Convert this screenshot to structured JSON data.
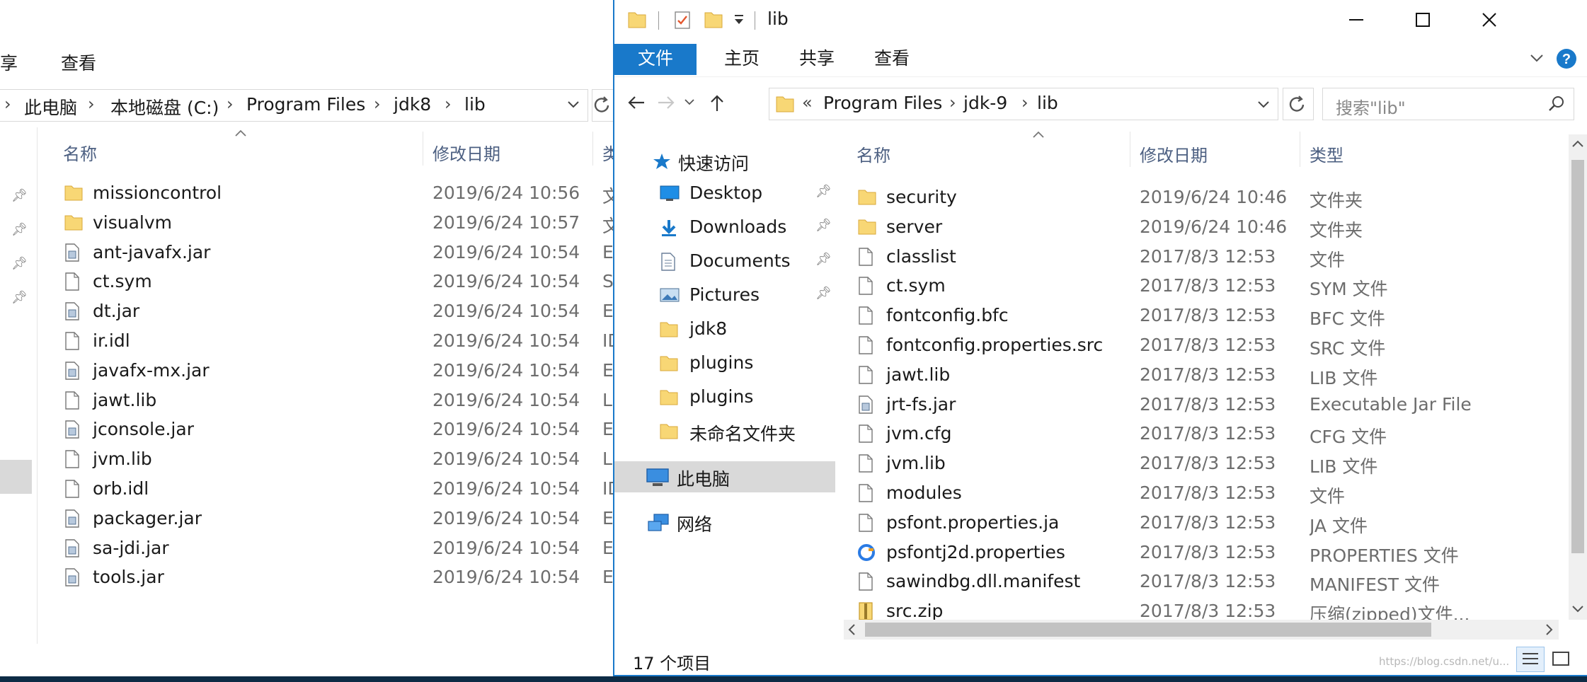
{
  "left_window": {
    "ribbon_tabs": [
      "享",
      "查看"
    ],
    "breadcrumb": [
      "此电脑",
      "本地磁盘 (C:)",
      "Program Files",
      "jdk8",
      "lib"
    ],
    "columns": {
      "name": "名称",
      "date": "修改日期",
      "type": "类"
    },
    "files": [
      {
        "name": "missioncontrol",
        "date": "2019/6/24 10:56",
        "type": "文",
        "icon": "folder-icon"
      },
      {
        "name": "visualvm",
        "date": "2019/6/24 10:57",
        "type": "文",
        "icon": "folder-icon"
      },
      {
        "name": "ant-javafx.jar",
        "date": "2019/6/24 10:54",
        "type": "E",
        "icon": "jar-file-icon"
      },
      {
        "name": "ct.sym",
        "date": "2019/6/24 10:54",
        "type": "S",
        "icon": "file-icon"
      },
      {
        "name": "dt.jar",
        "date": "2019/6/24 10:54",
        "type": "E",
        "icon": "jar-file-icon"
      },
      {
        "name": "ir.idl",
        "date": "2019/6/24 10:54",
        "type": "ID",
        "icon": "file-icon"
      },
      {
        "name": "javafx-mx.jar",
        "date": "2019/6/24 10:54",
        "type": "E",
        "icon": "jar-file-icon"
      },
      {
        "name": "jawt.lib",
        "date": "2019/6/24 10:54",
        "type": "L",
        "icon": "file-icon"
      },
      {
        "name": "jconsole.jar",
        "date": "2019/6/24 10:54",
        "type": "E",
        "icon": "jar-file-icon"
      },
      {
        "name": "jvm.lib",
        "date": "2019/6/24 10:54",
        "type": "L",
        "icon": "file-icon"
      },
      {
        "name": "orb.idl",
        "date": "2019/6/24 10:54",
        "type": "ID",
        "icon": "file-icon"
      },
      {
        "name": "packager.jar",
        "date": "2019/6/24 10:54",
        "type": "E",
        "icon": "jar-file-icon"
      },
      {
        "name": "sa-jdi.jar",
        "date": "2019/6/24 10:54",
        "type": "E",
        "icon": "jar-file-icon"
      },
      {
        "name": "tools.jar",
        "date": "2019/6/24 10:54",
        "type": "E",
        "icon": "jar-file-icon"
      }
    ]
  },
  "right_window": {
    "title": "lib",
    "ribbon_tabs": {
      "file": "文件",
      "home": "主页",
      "share": "共享",
      "view": "查看"
    },
    "breadcrumb": {
      "overflow": "«",
      "items": [
        "Program Files",
        "jdk-9",
        "lib"
      ]
    },
    "search_placeholder": "搜索\"lib\"",
    "nav": {
      "quick_access": "快速访问",
      "items": [
        {
          "label": "Desktop",
          "icon": "desktop-icon",
          "pinned": true
        },
        {
          "label": "Downloads",
          "icon": "downloads-icon",
          "pinned": true
        },
        {
          "label": "Documents",
          "icon": "documents-icon",
          "pinned": true
        },
        {
          "label": "Pictures",
          "icon": "pictures-icon",
          "pinned": true
        },
        {
          "label": "jdk8",
          "icon": "folder-icon",
          "pinned": false
        },
        {
          "label": "plugins",
          "icon": "folder-icon",
          "pinned": false
        },
        {
          "label": "plugins",
          "icon": "folder-icon",
          "pinned": false
        },
        {
          "label": "未命名文件夹",
          "icon": "folder-icon",
          "pinned": false
        }
      ],
      "this_pc": "此电脑",
      "network": "网络"
    },
    "columns": {
      "name": "名称",
      "date": "修改日期",
      "type": "类型"
    },
    "files": [
      {
        "name": "security",
        "date": "2019/6/24 10:46",
        "type": "文件夹",
        "icon": "folder-icon"
      },
      {
        "name": "server",
        "date": "2019/6/24 10:46",
        "type": "文件夹",
        "icon": "folder-icon"
      },
      {
        "name": "classlist",
        "date": "2017/8/3 12:53",
        "type": "文件",
        "icon": "file-icon"
      },
      {
        "name": "ct.sym",
        "date": "2017/8/3 12:53",
        "type": "SYM 文件",
        "icon": "file-icon"
      },
      {
        "name": "fontconfig.bfc",
        "date": "2017/8/3 12:53",
        "type": "BFC 文件",
        "icon": "file-icon"
      },
      {
        "name": "fontconfig.properties.src",
        "date": "2017/8/3 12:53",
        "type": "SRC 文件",
        "icon": "file-icon"
      },
      {
        "name": "jawt.lib",
        "date": "2017/8/3 12:53",
        "type": "LIB 文件",
        "icon": "file-icon"
      },
      {
        "name": "jrt-fs.jar",
        "date": "2017/8/3 12:53",
        "type": "Executable Jar File",
        "icon": "jar-file-icon"
      },
      {
        "name": "jvm.cfg",
        "date": "2017/8/3 12:53",
        "type": "CFG 文件",
        "icon": "file-icon"
      },
      {
        "name": "jvm.lib",
        "date": "2017/8/3 12:53",
        "type": "LIB 文件",
        "icon": "file-icon"
      },
      {
        "name": "modules",
        "date": "2017/8/3 12:53",
        "type": "文件",
        "icon": "file-icon"
      },
      {
        "name": "psfont.properties.ja",
        "date": "2017/8/3 12:53",
        "type": "JA 文件",
        "icon": "file-icon"
      },
      {
        "name": "psfontj2d.properties",
        "date": "2017/8/3 12:53",
        "type": "PROPERTIES 文件",
        "icon": "app-file-icon"
      },
      {
        "name": "sawindbg.dll.manifest",
        "date": "2017/8/3 12:53",
        "type": "MANIFEST 文件",
        "icon": "file-icon"
      },
      {
        "name": "src.zip",
        "date": "2017/8/3 12:53",
        "type": "压缩(zipped)文件...",
        "icon": "zip-file-icon"
      }
    ],
    "status": "17 个项目",
    "watermark": "https://blog.csdn.net/u..."
  },
  "colors": {
    "accent": "#1979ca",
    "folder": "#f8d775",
    "selection": "#d9d9d9",
    "header_text": "#4d6082"
  }
}
